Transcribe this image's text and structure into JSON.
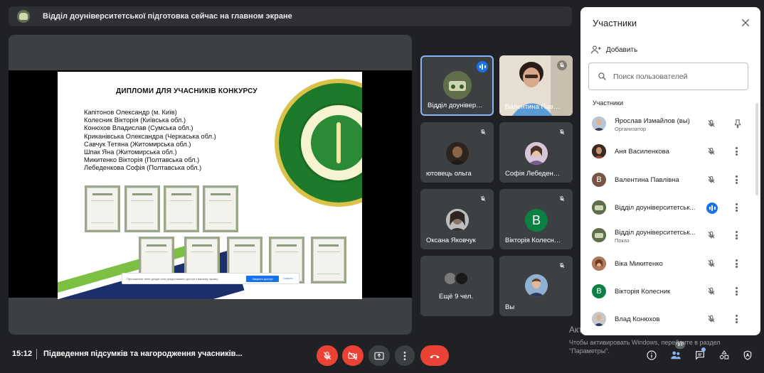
{
  "banner": {
    "text": "Відділ доуніверситетської підготовка сейчас на главном экране"
  },
  "slide": {
    "title": "ДИПЛОМИ ДЛЯ УЧАСНИКІВ КОНКУРСУ",
    "names": [
      "Капітонов Олександр (м. Київ)",
      "Колесник Вікторія (Київська обл.)",
      "Конюхов Владислав (Сумська обл.)",
      "Криканівська Олександра (Черкаська обл.)",
      "Савчук Тетяна (Житомирська обл.)",
      "Шпак Яна (Житомирська обл.)",
      "Микитенко Вікторія (Полтавська обл.)",
      "Лебеденкова Софія (Полтавська обл.)"
    ],
    "share_bar": {
      "text": "Приложение meet.google.com предоставило доступ к вашему экрану.",
      "stop": "Закрыть доступ",
      "hide": "Скрыть"
    }
  },
  "tiles": [
    {
      "name": "Відділ доунівер…",
      "speaking": true
    },
    {
      "name": "Валентина Пав…",
      "muted": true
    },
    {
      "name": "ютовець ольга",
      "muted": true
    },
    {
      "name": "Софія Лебеден…",
      "muted": true
    },
    {
      "name": "Оксана Яковчук",
      "muted": true
    },
    {
      "name": "Вікторія Колесн…",
      "muted": true,
      "initial": "В"
    },
    {
      "name": "Ещё 9 чел."
    },
    {
      "name": "Вы",
      "muted": true
    }
  ],
  "bottom": {
    "time": "15:12",
    "meeting_title": "Підведення підсумків та нагородження учасників...",
    "participants_count": "17"
  },
  "panel": {
    "title": "Участники",
    "add_label": "Добавить",
    "search_placeholder": "Поиск пользователей",
    "section_label": "Участники",
    "participants": [
      {
        "name": "Ярослав Измайлов (вы)",
        "sub": "Организатор"
      },
      {
        "name": "Аня Василенкова"
      },
      {
        "name": "Валентина Павлівна",
        "initial": "В"
      },
      {
        "name": "Відділ доуніверситетськ..."
      },
      {
        "name": "Відділ доуніверситетськ...",
        "sub": "Показ"
      },
      {
        "name": "Віка Микитенко"
      },
      {
        "name": "Вікторія Колесник",
        "initial": "В"
      },
      {
        "name": "Влад Конюхов"
      }
    ]
  },
  "watermark": {
    "title": "Активация Windows",
    "text": "Чтобы активировать Windows, перейдите в раздел \"Параметры\"."
  },
  "colors": {
    "accent": "#1a73e8",
    "danger": "#ea4335",
    "bg": "#202124",
    "tile": "#3c4043"
  }
}
